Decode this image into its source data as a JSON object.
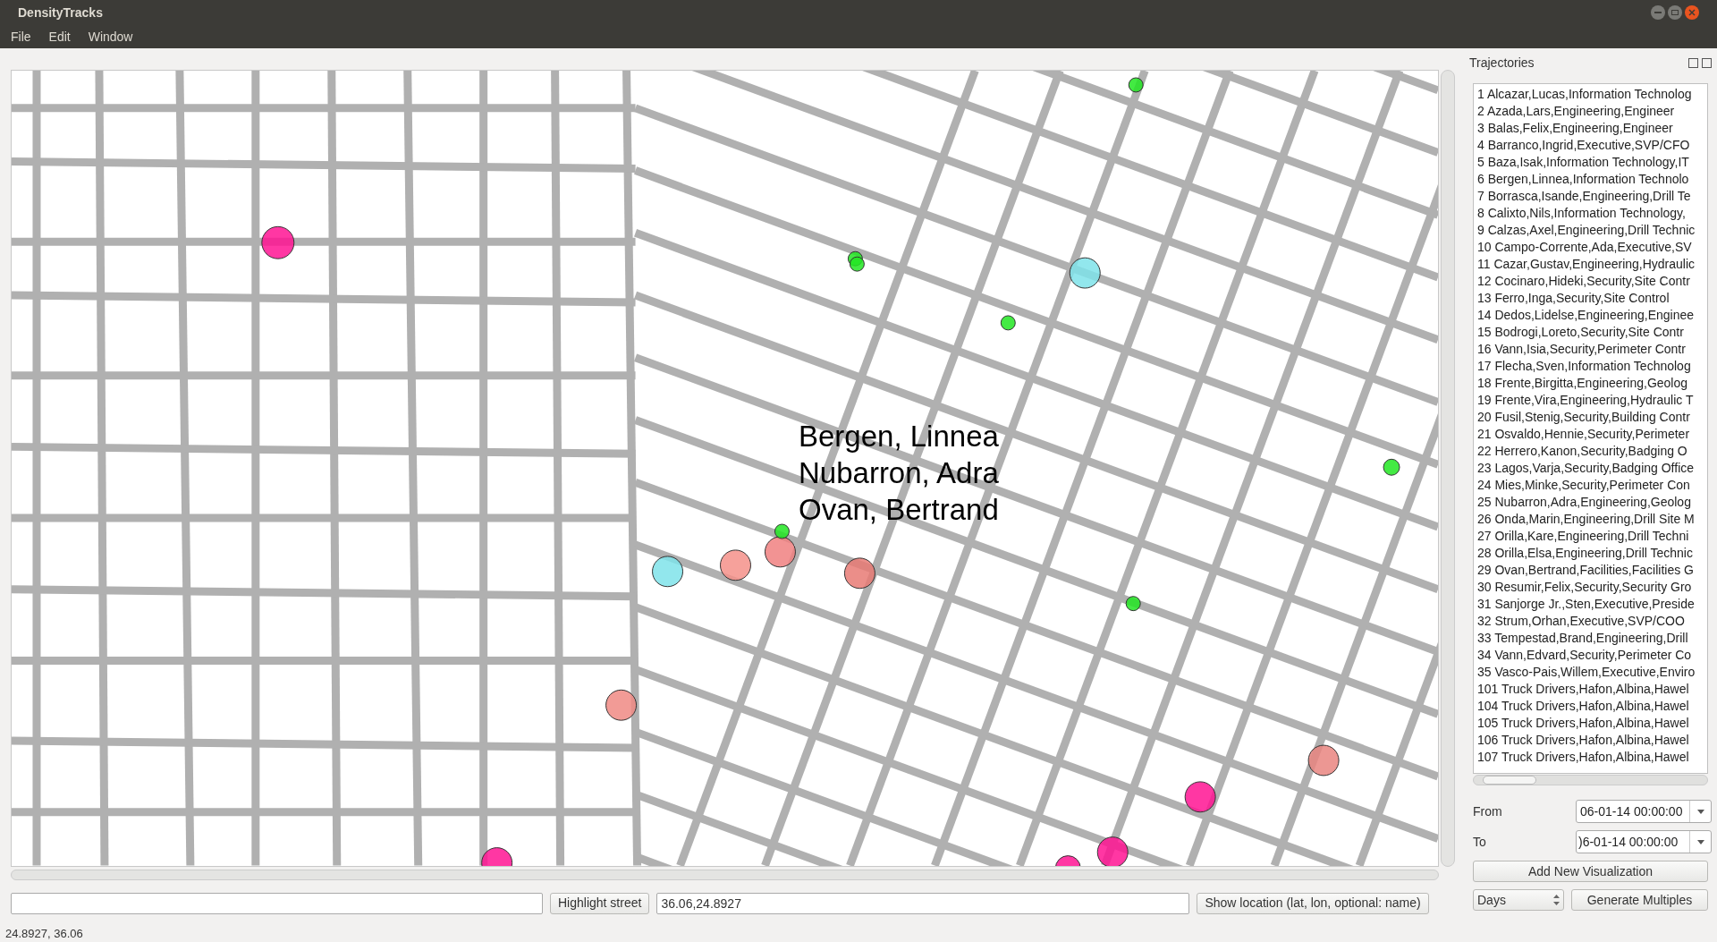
{
  "window": {
    "title": "DensityTracks"
  },
  "menu": [
    "File",
    "Edit",
    "Window"
  ],
  "map": {
    "labels": [
      "Bergen, Linnea",
      "Nubarron, Adra",
      "Ovan, Bertrand"
    ]
  },
  "highlight_button": "Highlight street",
  "location_field": {
    "value": "36.06,24.8927"
  },
  "show_location_button": "Show location (lat, lon, optional: name)",
  "status_bar": "24.8927, 36.06",
  "panel": {
    "title": "Trajectories",
    "items": [
      "1 Alcazar,Lucas,Information Technolog",
      "2 Azada,Lars,Engineering,Engineer",
      "3 Balas,Felix,Engineering,Engineer",
      "4 Barranco,Ingrid,Executive,SVP/CFO",
      "5 Baza,Isak,Information Technology,IT",
      "6 Bergen,Linnea,Information Technolo",
      "7 Borrasca,Isande,Engineering,Drill Te",
      "8 Calixto,Nils,Information Technology,",
      "9 Calzas,Axel,Engineering,Drill Technic",
      "10 Campo-Corrente,Ada,Executive,SV",
      "11 Cazar,Gustav,Engineering,Hydraulic",
      "12 Cocinaro,Hideki,Security,Site Contr",
      "13 Ferro,Inga,Security,Site Control",
      "14 Dedos,Lidelse,Engineering,Enginee",
      "15 Bodrogi,Loreto,Security,Site Contr",
      "16 Vann,Isia,Security,Perimeter Contr",
      "17 Flecha,Sven,Information Technolog",
      "18 Frente,Birgitta,Engineering,Geolog",
      "19 Frente,Vira,Engineering,Hydraulic T",
      "20 Fusil,Stenig,Security,Building Contr",
      "21 Osvaldo,Hennie,Security,Perimeter",
      "22 Herrero,Kanon,Security,Badging O",
      "23 Lagos,Varja,Security,Badging Office",
      "24 Mies,Minke,Security,Perimeter Con",
      "25 Nubarron,Adra,Engineering,Geolog",
      "26 Onda,Marin,Engineering,Drill Site M",
      "27 Orilla,Kare,Engineering,Drill Techni",
      "28 Orilla,Elsa,Engineering,Drill Technic",
      "29 Ovan,Bertrand,Facilities,Facilities G",
      "30 Resumir,Felix,Security,Security Gro",
      "31 Sanjorge Jr.,Sten,Executive,Preside",
      "32 Strum,Orhan,Executive,SVP/COO",
      "33 Tempestad,Brand,Engineering,Drill",
      "34 Vann,Edvard,Security,Perimeter Co",
      "35 Vasco-Pais,Willem,Executive,Enviro",
      "101 Truck Drivers,Hafon,Albina,Hawel",
      "104 Truck Drivers,Hafon,Albina,Hawel",
      "105 Truck Drivers,Hafon,Albina,Hawel",
      "106 Truck Drivers,Hafon,Albina,Hawel",
      "107 Truck Drivers,Hafon,Albina,Hawel"
    ],
    "from_label": "From",
    "from_value": "06-01-14 00:00:00",
    "to_label": "To",
    "to_value": ")6-01-14 00:00:00",
    "add_button": "Add New Visualization",
    "unit_select": "Days",
    "generate_button": "Generate Multiples"
  }
}
